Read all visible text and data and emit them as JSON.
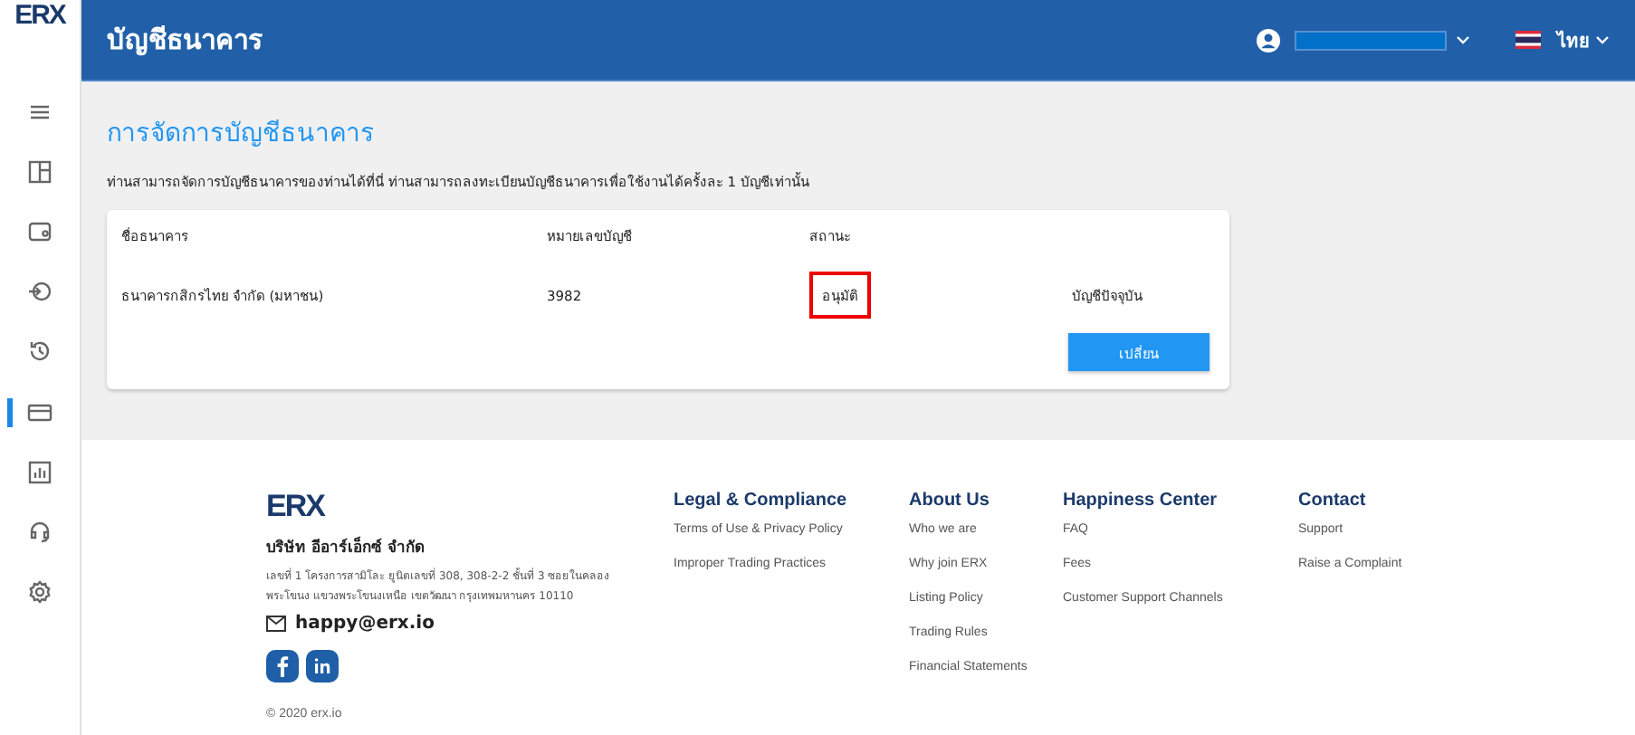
{
  "logo": "ERX",
  "sidebar": {
    "items": [
      {
        "kind": "menu",
        "selected": false
      },
      {
        "kind": "dashboard",
        "selected": false
      },
      {
        "kind": "wallet",
        "selected": false
      },
      {
        "kind": "deposit",
        "selected": false
      },
      {
        "kind": "history",
        "selected": false
      },
      {
        "kind": "card",
        "selected": true
      },
      {
        "kind": "chart",
        "selected": false
      },
      {
        "kind": "support",
        "selected": false
      },
      {
        "kind": "settings",
        "selected": false
      }
    ]
  },
  "header": {
    "title": "บัญชีธนาคาร",
    "language": "ไทย"
  },
  "page": {
    "title": "การจัดการบัญชีธนาคาร",
    "description": "ท่านสามารถจัดการบัญชีธนาคารของท่านได้ที่นี่ ท่านสามารถลงทะเบียนบัญชีธนาคารเพื่อใช้งานได้ครั้งละ 1 บัญชีเท่านั้น"
  },
  "table": {
    "columns": [
      "ชื่อธนาคาร",
      "หมายเลขบัญชี",
      "สถานะ"
    ],
    "rows": [
      {
        "bank": "ธนาคารกสิกรไทย จำกัด (มหาชน)",
        "account": "3982",
        "status": "อนุมัติ",
        "status_highlighted": true,
        "note": "บัญชีปัจจุบัน"
      }
    ]
  },
  "change_button": "เปลี่ยน",
  "footer": {
    "logo": "ERX",
    "company": "บริษัท อีอาร์เอ็กซ์ จำกัด",
    "address": "เลขที่ 1 โครงการสามิโละ ยูนิตเลขที่ 308, 308-2-2 ชั้นที่ 3 ซอยในคลอง พระโขนง แขวงพระโขนงเหนือ เขตวัฒนา กรุงเทพมหานคร 10110",
    "email": "happy@erx.io",
    "columns": [
      {
        "title": "Legal & Compliance",
        "links": [
          "Terms of Use & Privacy Policy",
          "Improper Trading Practices"
        ]
      },
      {
        "title": "About Us",
        "links": [
          "Who we are",
          "Why join ERX",
          "Listing Policy",
          "Trading Rules",
          "Financial Statements"
        ]
      },
      {
        "title": "Happiness Center",
        "links": [
          "FAQ",
          "Fees",
          "Customer Support Channels"
        ]
      },
      {
        "title": "Contact",
        "links": [
          "Support",
          "Raise a Complaint"
        ]
      }
    ],
    "copyright": "© 2020 erx.io"
  }
}
